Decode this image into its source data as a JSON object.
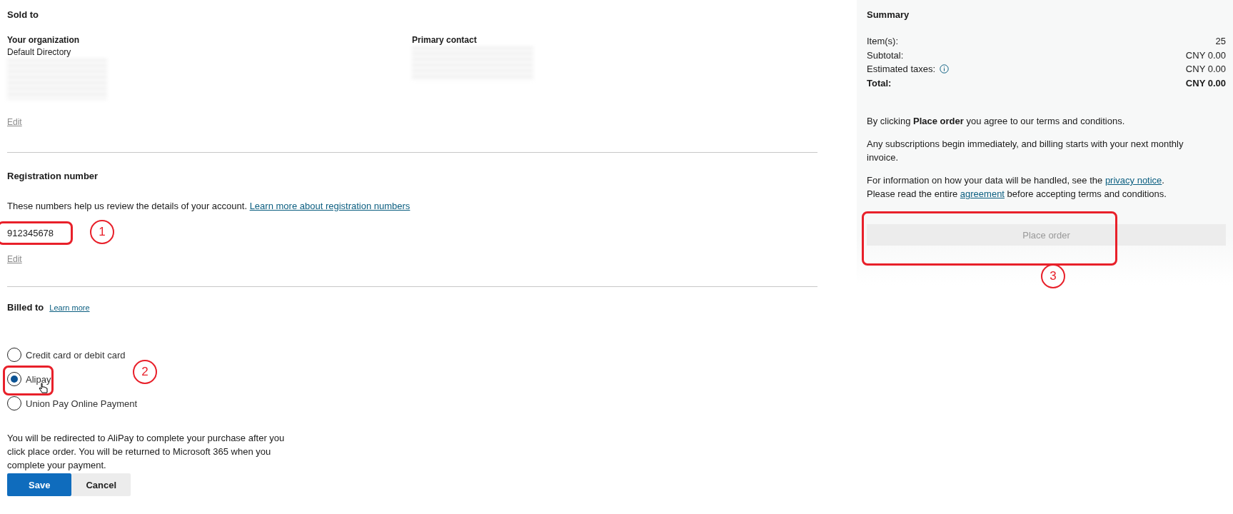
{
  "sold_to": {
    "title": "Sold to",
    "organization": {
      "label": "Your organization",
      "value": "Default Directory",
      "redacted": true
    },
    "primary_contact": {
      "label": "Primary contact",
      "redacted": true
    },
    "edit_link": "Edit"
  },
  "registration": {
    "title": "Registration number",
    "description": "These numbers help us review the details of your account.",
    "learn_link": "Learn more about registration numbers",
    "value": "912345678",
    "annotation": "1",
    "edit_link": "Edit"
  },
  "billed_to": {
    "title": "Billed to",
    "learn_link": "Learn more",
    "options": [
      {
        "label": "Credit card or debit card",
        "selected": false
      },
      {
        "label": "Alipay",
        "selected": true,
        "annotation": "2"
      },
      {
        "label": "Union Pay Online Payment",
        "selected": false
      }
    ],
    "note": "You will be redirected to AliPay to complete your purchase after you click place order. You will be returned to Microsoft 365 when you complete your payment.",
    "buttons": [
      {
        "label": "Save",
        "kind": "primary"
      },
      {
        "label": "Cancel",
        "kind": "secondary"
      }
    ]
  },
  "summary": {
    "title": "Summary",
    "rows": [
      {
        "label": "Item(s):",
        "value": "25",
        "info": false,
        "total": false
      },
      {
        "label": "Subtotal:",
        "value": "CNY 0.00",
        "info": false,
        "total": false
      },
      {
        "label": "Estimated taxes:",
        "value": "CNY 0.00",
        "info": true,
        "total": false
      },
      {
        "label": "Total:",
        "value": "CNY 0.00",
        "info": false,
        "total": true
      }
    ],
    "terms": "By clicking **Place order** you agree to our terms and conditions.",
    "billing_note": "Any subscriptions begin immediately, and billing starts with your next monthly invoice.",
    "privacy_before": "For information on how your data will be handled, see the",
    "privacy_link": "privacy notice",
    "privacy_after": ".",
    "agreement_before": "Please read the entire",
    "agreement_link": "agreement",
    "agreement_after": "before accepting terms and conditions.",
    "place_order": {
      "label": "Place order",
      "disabled": true,
      "annotation": "3"
    }
  }
}
